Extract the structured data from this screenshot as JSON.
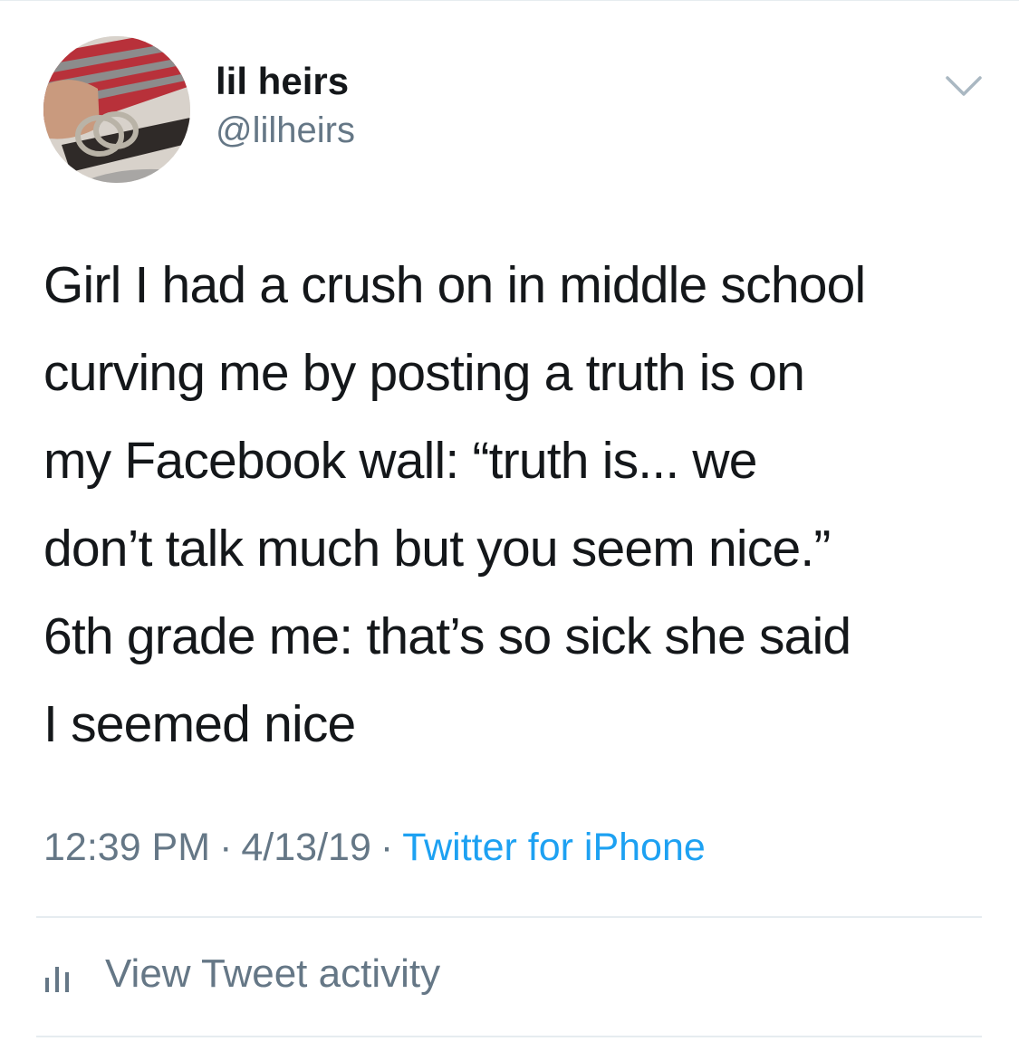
{
  "tweet": {
    "author_name": "lil heirs",
    "author_handle": "@lilheirs",
    "text_lines": [
      "Girl I had a crush on in middle school",
      "curving me by posting a truth is on",
      "my Facebook wall: “truth is... we",
      "don’t talk much but you seem nice.”",
      "6th grade me: that’s so sick she said",
      "I seemed nice"
    ],
    "time": "12:39 PM",
    "date": "4/13/19",
    "separator": "·",
    "source": "Twitter for iPhone"
  },
  "actions": {
    "view_activity_label": "View Tweet activity"
  },
  "icons": {
    "menu": "chevron-down-icon",
    "activity": "bar-chart-icon"
  },
  "colors": {
    "text": "#14171a",
    "secondary": "#657786",
    "link": "#1da1f2",
    "divider": "#e6ecf0"
  }
}
